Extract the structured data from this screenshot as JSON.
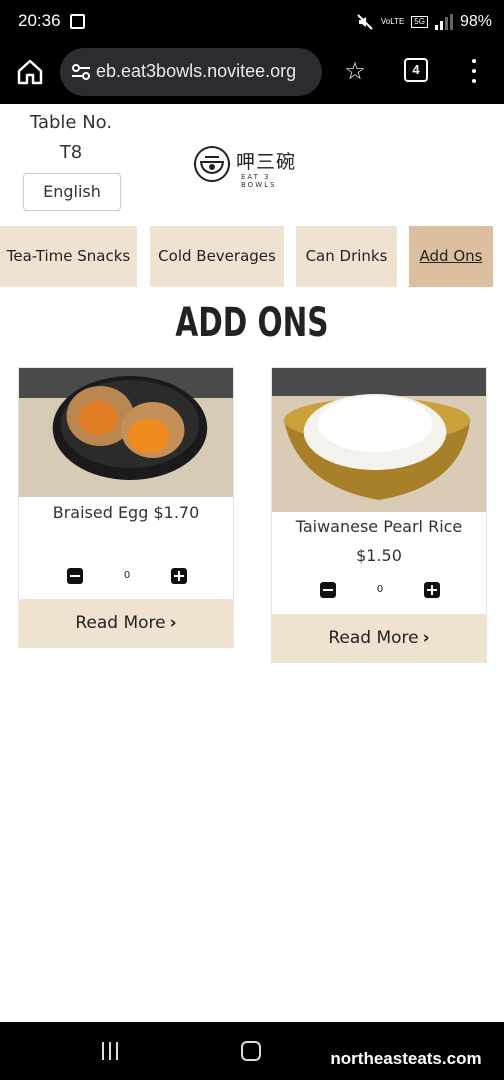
{
  "status_bar": {
    "time": "20:36",
    "network": "5G",
    "volte": "VoLTE",
    "battery": "98%"
  },
  "browser": {
    "url": "eb.eat3bowls.novitee.org",
    "tab_count": "4",
    "icons": [
      "home-icon",
      "site-settings-icon",
      "star-icon",
      "tabs-icon",
      "more-vert-icon"
    ]
  },
  "header": {
    "table_label": "Table No.",
    "table_number": "T8",
    "language_button": "English",
    "logo_cn": "呷三碗",
    "logo_en": "EAT 3 BOWLS"
  },
  "categories": [
    {
      "label": "Tea-Time Snacks",
      "active": false
    },
    {
      "label": "Cold Beverages",
      "active": false
    },
    {
      "label": "Can Drinks",
      "active": false
    },
    {
      "label": "Add Ons",
      "active": true
    }
  ],
  "section_title": "ADD ONS",
  "products": [
    {
      "name": "Braised Egg $1.70",
      "price": "",
      "quantity": "0",
      "read_more": "Read More"
    },
    {
      "name": "Taiwanese Pearl Rice",
      "price": "$1.50",
      "quantity": "0",
      "read_more": "Read More"
    }
  ],
  "watermark": "northeasteats.com",
  "colors": {
    "tab_bg": "#efe2d1",
    "tab_active_bg": "#dcbf9e",
    "system_bar": "#000000"
  }
}
